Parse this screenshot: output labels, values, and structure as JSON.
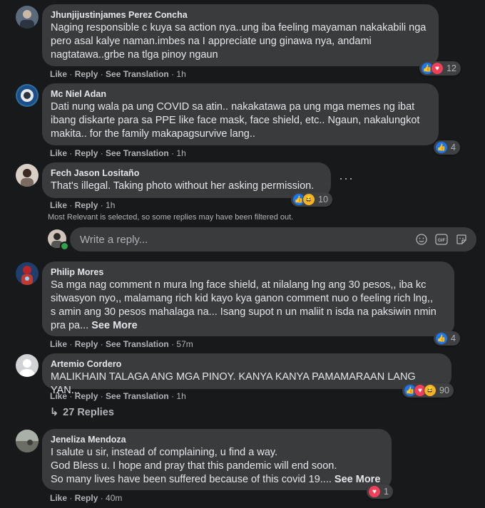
{
  "comments": [
    {
      "author": "Jhunjijustinjames Perez Concha",
      "text": "Naging responsible c kuya sa action nya..ung iba feeling mayaman nakakabili nga\npero asal kalye naman.imbes na I appreciate ung ginawa nya, andami\nnagtatawa..grbe na tlga pinoy ngaun",
      "actions": {
        "like": "Like",
        "reply": "Reply",
        "translate": "See Translation",
        "time": "1h"
      },
      "reactions": {
        "icons": [
          "like",
          "love"
        ],
        "count": "12"
      }
    },
    {
      "author": "Mc Niel Adan",
      "text": "Dati nung wala pa ung COVID sa atin.. nakakatawa pa ung mga memes ng ibat\nibang diskarte para sa PPE like face mask, face shield, etc.. Ngaun, nakalungkot\nmakita.. for the family makapagsurvive lang..",
      "actions": {
        "like": "Like",
        "reply": "Reply",
        "translate": "See Translation",
        "time": "1h"
      },
      "reactions": {
        "icons": [
          "like"
        ],
        "count": "4"
      }
    },
    {
      "author": "Fech Jason Lositaño",
      "text": "That's illegal. Taking photo without her asking permission.",
      "actions": {
        "like": "Like",
        "reply": "Reply",
        "time": "1h"
      },
      "reactions": {
        "icons": [
          "like",
          "haha"
        ],
        "count": "10"
      }
    },
    {
      "author": "Philip Mores",
      "text": "Sa mga nag comment n mura lng face shield, at nilalang lng ang 30 pesos,, iba kc\nsitwasyon nyo,, malamang rich kid kayo kya ganon comment nuo o feeling rich lng,,\ns amin ang 30 pesos mahalaga na... Isang supot n un maliit n isda na paksiwin nmin\npra pa...",
      "see_more": "See More",
      "actions": {
        "like": "Like",
        "reply": "Reply",
        "translate": "See Translation",
        "time": "57m"
      },
      "reactions": {
        "icons": [
          "like"
        ],
        "count": "4"
      }
    },
    {
      "author": "Artemio Cordero",
      "text": "MALIKHAIN TALAGA ANG MGA PINOY. KANYA KANYA PAMAMARAAN LANG YAN...",
      "actions": {
        "like": "Like",
        "reply": "Reply",
        "translate": "See Translation",
        "time": "1h"
      },
      "reactions": {
        "icons": [
          "like",
          "love",
          "haha"
        ],
        "count": "90"
      }
    },
    {
      "author": "Jeneliza Mendoza",
      "text": "I salute u sir, instead of complaining, u find a way.\nGod Bless u. I hope and pray that this pandemic will end soon.\nSo many lives have been suffered because of this covid 19....",
      "see_more": "See More",
      "actions": {
        "like": "Like",
        "reply": "Reply",
        "time": "40m"
      },
      "reactions": {
        "icons": [
          "love"
        ],
        "count": "1"
      }
    }
  ],
  "filter_notice": "Most Relevant is selected, so some replies may have been filtered out.",
  "reply_box": {
    "placeholder": "Write a reply..."
  },
  "replies_link": "27 Replies",
  "colors": {
    "background": "#18191a",
    "bubble": "#3a3b3c",
    "text": "#e4e6eb",
    "secondary": "#b0b3b8",
    "like": "#1877f2",
    "love": "#f33e58",
    "haha": "#f7b125"
  }
}
